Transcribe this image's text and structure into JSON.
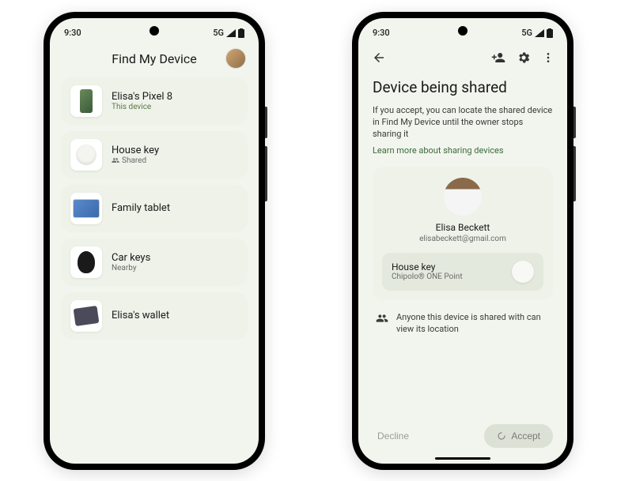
{
  "status": {
    "time": "9:30",
    "network": "5G"
  },
  "left": {
    "title": "Find My Device",
    "devices": [
      {
        "name": "Elisa's Pixel 8",
        "sub": "This device",
        "subColor": "green",
        "thumb": "pixel"
      },
      {
        "name": "House key",
        "sub": "Shared",
        "subColor": "gray",
        "thumb": "key",
        "hasShareIcon": true
      },
      {
        "name": "Family tablet",
        "sub": "",
        "thumb": "tablet"
      },
      {
        "name": "Car keys",
        "sub": "Nearby",
        "subColor": "gray",
        "thumb": "carkey"
      },
      {
        "name": "Elisa's wallet",
        "sub": "",
        "thumb": "wallet"
      }
    ]
  },
  "right": {
    "title": "Device being shared",
    "description": "If you accept, you can locate the shared device in Find My Device until the owner stops sharing it",
    "learnMore": "Learn more about sharing devices",
    "sharer": {
      "name": "Elisa Beckett",
      "email": "elisabeckett@gmail.com"
    },
    "sharedDevice": {
      "name": "House key",
      "sub": "Chipolo® ONE Point"
    },
    "infoText": "Anyone this device is shared with can view its location",
    "declineLabel": "Decline",
    "acceptLabel": "Accept"
  }
}
